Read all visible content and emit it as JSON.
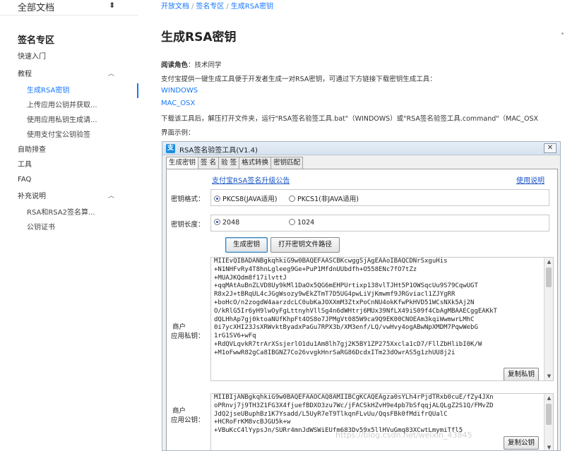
{
  "sidebar": {
    "doc_selector": "全部文档",
    "section_title": "签名专区",
    "items": [
      {
        "label": "快速入门",
        "level": 0
      },
      {
        "label": "教程",
        "level": 0,
        "expanded": true
      },
      {
        "label": "生成RSA密钥",
        "level": 1,
        "active": true
      },
      {
        "label": "上传应用公钥并获取...",
        "level": 1
      },
      {
        "label": "使用应用私钥生成请...",
        "level": 1
      },
      {
        "label": "使用支付宝公钥验签",
        "level": 1
      },
      {
        "label": "自助排查",
        "level": 0
      },
      {
        "label": "工具",
        "level": 0
      },
      {
        "label": "FAQ",
        "level": 0
      },
      {
        "label": "补充说明",
        "level": 0,
        "expanded": true
      },
      {
        "label": "RSA和RSA2签名算...",
        "level": 1
      },
      {
        "label": "公钥证书",
        "level": 1
      }
    ]
  },
  "breadcrumb": [
    "开放文档",
    "签名专区",
    "生成RSA密钥"
  ],
  "page_title": "生成RSA密钥",
  "content": {
    "role_label": "阅读角色",
    "role_value": "：技术同学",
    "intro": "支付宝提供一键生成工具便于开发者生成一对RSA密钥，可通过下方链接下载密钥生成工具：",
    "link_windows": "WINDOWS",
    "link_mac": "MAC_OSX",
    "instructions": "下载该工具后，解压打开文件夹，运行\"RSA签名验签工具.bat\"（WINDOWS）或\"RSA签名验签工具.command\"（MAC_OSX",
    "example_label": "界面示例："
  },
  "tool": {
    "title": "RSA签名验签工具(V1.4)",
    "close": "✕",
    "tabs": [
      "生成密钥",
      "签 名",
      "验 签",
      "格式转换",
      "密钥匹配"
    ],
    "upgrade_link": "支付宝RSA签名升级公告",
    "help_link": "使用说明",
    "format_label": "密钥格式：",
    "format_opt1": "PKCS8(JAVA适用)",
    "format_opt2": "PKCS1(非JAVA适用)",
    "length_label": "密钥长度：",
    "length_opt1": "2048",
    "length_opt2": "1024",
    "generate_btn": "生成密钥",
    "open_path_btn": "打开密钥文件路径",
    "private_label_1": "商户",
    "private_label_2": "应用私钥：",
    "private_key_lines": [
      "MIIEvQIBADANBgkqhkiG9w0BAQEFAASCBKcwggSjAgEAAoIBAQCDNrSxguHis",
      "+N1NHFvRy4T8hnLgleeg9Ge+PuP1MfdnUUbdfh+O558ENc7fO7tZz",
      "+MUAJKQdm8f17ilvttJ",
      "+qqMAtAuBnZLVD8Uy9kMl1DaOx5QG6mEHPUrtixp138vlTJHt5P1OWSqcUu9S79CqwUGT",
      "R8x2J+tBRqUL4cJGgWsozy9wEkZTmT7D5UG4pwLiVjKmwmf9JRGviacl1ZJYgRR",
      "+boHcO/n2zogdW4aarzdcLC0ubKaJOXXmM3ZtxPoCnNU4okKfwPkHVD51WCsNXk5Aj2N",
      "O/kRlG5Ir6yH9lwOyFgLttnyhVllSg4n6dWHtrj6MUx39NfLX49iS09f4CbAgMBAAECggEAKkT",
      "dQLHhAp7gj0ktoaNUfKhpFt4OS8o7JPMgVt085W9ca9Q9EK00CNOEAm3kqiWwmwrLMhC",
      "0i7ycXHI23JsXRWvktByadxPaGu7RPX3b/XM3enf/LQ/vwHvy4ogABwNpXMDM7PqwWebG",
      "1rG1SV6+wFq",
      "+RdQVLqvkR7trArXSsjerlO1du1Am8lh7gj2K5BY1ZP275Xxcla1cD7/FllZbHlibI0K/W",
      "+M1oFwwR82gCa8IBGNZ7Co26vvgkHnrSaRG86DcdxITm23dOwrAS5g1zhUU8j2i"
    ],
    "copy_private_btn": "复制私钥",
    "public_label_1": "商户",
    "public_label_2": "应用公钥：",
    "public_key_lines": [
      "MIIBIjANBgkqhkiG9w0BAQEFAAOCAQ8AMIIBCgKCAQEAgza0sYLh4rPjdTRxb0cuE/fZy4JXn",
      "oPRnvj7j9TH3Z1FG3X4fjuefBDXO3zu7Wc/jFACSkHZvH9e4pb7bSfqqjALQLgZ2S1Q/FMvZD",
      "JdQ2jseUBuphBz1K7Ysadd/L5UyR7eT9TlkqnFLvUu/QqsFBk0fMdifrQUalC",
      "+HCRoFrKM8vcBJGU5k+w",
      "+VBuKcC4lYypsJn/SURr4mnJdWSWiEUfm683Dv59x5llHVuGmq83XCwtLmymiTfl5"
    ],
    "copy_public_btn": "复制公钥"
  },
  "watermark": "https://blog.csdn.net/weixin_43845"
}
